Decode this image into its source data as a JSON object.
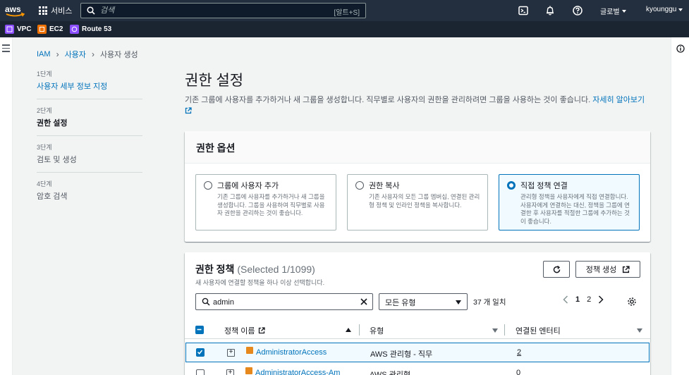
{
  "topnav": {
    "logo_text": "aws",
    "services_label": "서비스",
    "search_placeholder": "검색",
    "search_shortcut": "[알트+S]",
    "region_label": "글로벌",
    "user_label": "kyounggu"
  },
  "favorites": [
    {
      "label": "VPC",
      "icon": "vpc-icon",
      "color": "#8c4fff"
    },
    {
      "label": "EC2",
      "icon": "ec2-icon",
      "color": "#ed7100"
    },
    {
      "label": "Route 53",
      "icon": "route53-icon",
      "color": "#8c4fff"
    }
  ],
  "breadcrumb": {
    "items": [
      "IAM",
      "사용자",
      "사용자 생성"
    ]
  },
  "steps": [
    {
      "num": "1단계",
      "label": "사용자 세부 정보 지정",
      "state": "link"
    },
    {
      "num": "2단계",
      "label": "권한 설정",
      "state": "active"
    },
    {
      "num": "3단계",
      "label": "검토 및 생성",
      "state": "pending"
    },
    {
      "num": "4단계",
      "label": "암호 검색",
      "state": "pending"
    }
  ],
  "page": {
    "title": "권한 설정",
    "description": "기존 그룹에 사용자를 추가하거나 새 그룹을 생성합니다. 직무별로 사용자의 권한을 관리하려면 그룹을 사용하는 것이 좋습니다.",
    "learn_more": "자세히 알아보기"
  },
  "permission_options": {
    "title": "권한 옵션",
    "options": [
      {
        "title": "그룹에 사용자 추가",
        "desc": "기존 그룹에 사용자를 추가하거나 새 그룹을 생성합니다. 그룹을 사용하여 직무별로 사용자 권한을 관리하는 것이 좋습니다.",
        "selected": false
      },
      {
        "title": "권한 복사",
        "desc": "기존 사용자의 모든 그룹 멤버십, 연결된 관리형 정책 및 인라인 정책을 복사합니다.",
        "selected": false
      },
      {
        "title": "직접 정책 연결",
        "desc": "관리형 정책을 사용자에게 직접 연결합니다. 사용자에게 연결하는 대신, 정책을 그룹에 연결한 후 사용자를 적절한 그룹에 추가하는 것이 좋습니다.",
        "selected": true
      }
    ]
  },
  "policies": {
    "title": "권한 정책",
    "count": "(Selected 1/1099)",
    "subtitle": "새 사용자에 연결할 정책을 하나 이상 선택합니다.",
    "create_label": "정책 생성",
    "filter_value": "admin",
    "type_select": "모든 유형",
    "match_text": "37 개 일치",
    "pages": [
      "1",
      "2"
    ],
    "current_page": "1",
    "columns": [
      "정책 이름",
      "유형",
      "연결된 엔터티"
    ],
    "rows": [
      {
        "name": "AdministratorAccess",
        "type": "AWS 관리형 - 직무",
        "entities": "2",
        "checked": true
      },
      {
        "name": "AdministratorAccess-Am",
        "type": "AWS 관리형",
        "entities": "0",
        "checked": false
      }
    ]
  }
}
